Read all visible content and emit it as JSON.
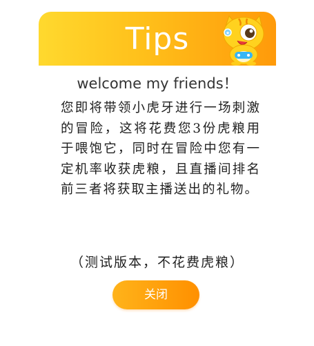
{
  "dialog": {
    "title": "Tips",
    "welcome": "welcome my friends！",
    "message": "您即将带领小虎牙进行一场刺激的冒险，这将花费您3份虎粮用于喂饱它，同时在冒险中您有一定机率收获虎粮，且直播间排名前三者将获取主播送出的礼物。",
    "note": "（测试版本，不花费虎粮）",
    "close_label": "关闭"
  },
  "colors": {
    "header_start": "#ffd92e",
    "header_end": "#ff9a0a",
    "button": "#ff9a0a",
    "text": "#1f1f1f"
  },
  "icons": {
    "mascot": "tiger-mascot-icon"
  }
}
